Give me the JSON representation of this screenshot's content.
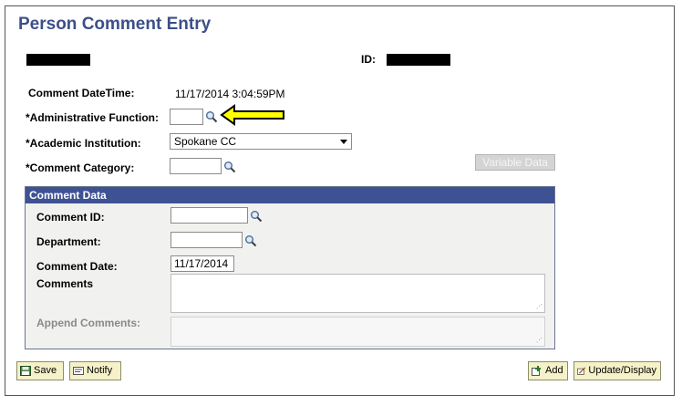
{
  "page": {
    "title": "Person Comment Entry",
    "id_label": "ID:"
  },
  "form": {
    "comment_datetime_label": "Comment DateTime:",
    "comment_datetime_value": "11/17/2014  3:04:59PM",
    "admin_function_label": "*Administrative Function:",
    "admin_function_value": "",
    "academic_institution_label": "*Academic Institution:",
    "academic_institution_value": "Spokane CC",
    "comment_category_label": "*Comment Category:",
    "comment_category_value": "",
    "variable_data_label": "Variable Data"
  },
  "comment_data": {
    "header": "Comment Data",
    "comment_id_label": "Comment ID:",
    "comment_id_value": "",
    "department_label": "Department:",
    "department_value": "",
    "comment_date_label": "Comment Date:",
    "comment_date_value": "11/17/2014",
    "comments_label": "Comments",
    "append_comments_label": "Append Comments:"
  },
  "toolbar": {
    "save_label": "Save",
    "notify_label": "Notify",
    "add_label": "Add",
    "update_display_label": "Update/Display"
  },
  "colors": {
    "title": "#3c4f8a",
    "group_header": "#3e5293",
    "arrow_fill": "#ffff00",
    "button_bg": "#f5f1c8"
  }
}
